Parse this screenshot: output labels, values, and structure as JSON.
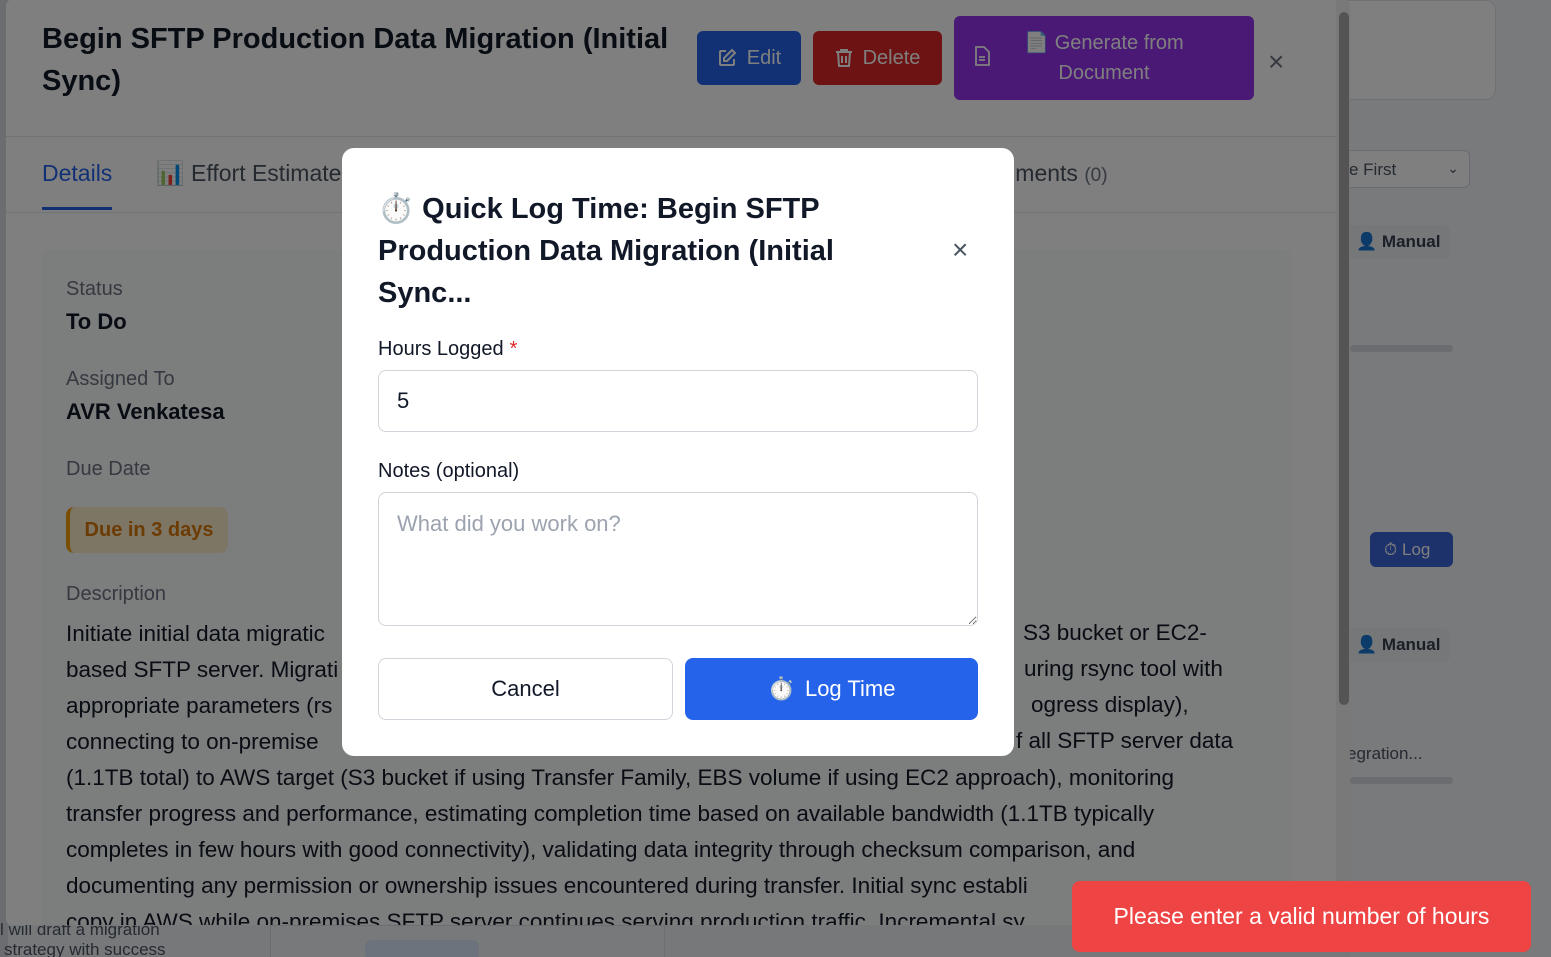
{
  "task": {
    "title": "Begin SFTP Production Data Migration (Initial Sync)",
    "buttons": {
      "edit": "Edit",
      "delete": "Delete",
      "generate": "Generate from Document"
    },
    "close": "×"
  },
  "tabs": [
    {
      "label": "Details",
      "active": true
    },
    {
      "label": "Effort Estimate",
      "icon": "bar-chart-icon"
    },
    {
      "label": "chments",
      "count": "(0)"
    }
  ],
  "details": {
    "status_label": "Status",
    "status_value": "To Do",
    "assigned_label": "Assigned To",
    "assigned_value": "AVR Venkatesa",
    "due_label": "Due Date",
    "due_value": "Due in 3 days",
    "description_label": "Description",
    "description_lines": [
      "Initiate initial data migratic",
      "based SFTP server. Migrati",
      "appropriate parameters (rs",
      "connecting to on-premise",
      "(1.1TB total) to AWS target (S3 bucket if using Transfer Family, EBS volume if using EC2 approach), monitoring",
      "transfer progress and performance, estimating completion time based on available bandwidth (1.1TB typically",
      "completes in few hours with good connectivity), validating data integrity through checksum comparison, and",
      "documenting any permission or ownership issues encountered during transfer. Initial sync establi",
      "copy in AWS while on-premises SFTP server continues serving production traffic. Incremental sy"
    ],
    "description_right_fragments": [
      "S3 bucket or EC2-",
      "uring rsync tool with",
      "ogress display),",
      "f all SFTP server data"
    ]
  },
  "background": {
    "sort_select": "e First",
    "pill_1": "Manual",
    "pill_2": "Manual",
    "log_button": "Log",
    "truncated": "egration...",
    "bottom_left": "strategy with success",
    "bottom_left2": "l will draft a migration"
  },
  "modal": {
    "title": "Quick Log Time: Begin SFTP Production Data Migration (Initial Sync...",
    "title_icon": "stopwatch-icon",
    "close": "×",
    "hours_label": "Hours Logged",
    "hours_required": "*",
    "hours_value": "5",
    "notes_label": "Notes (optional)",
    "notes_placeholder": "What did you work on?",
    "cancel": "Cancel",
    "log_time": "Log Time"
  },
  "toast": {
    "message": "Please enter a valid number of hours",
    "color": "#ef4444"
  },
  "colors": {
    "primary": "#2563eb",
    "danger": "#dc2626",
    "purple": "#9333ea",
    "warning": "#d97706"
  }
}
